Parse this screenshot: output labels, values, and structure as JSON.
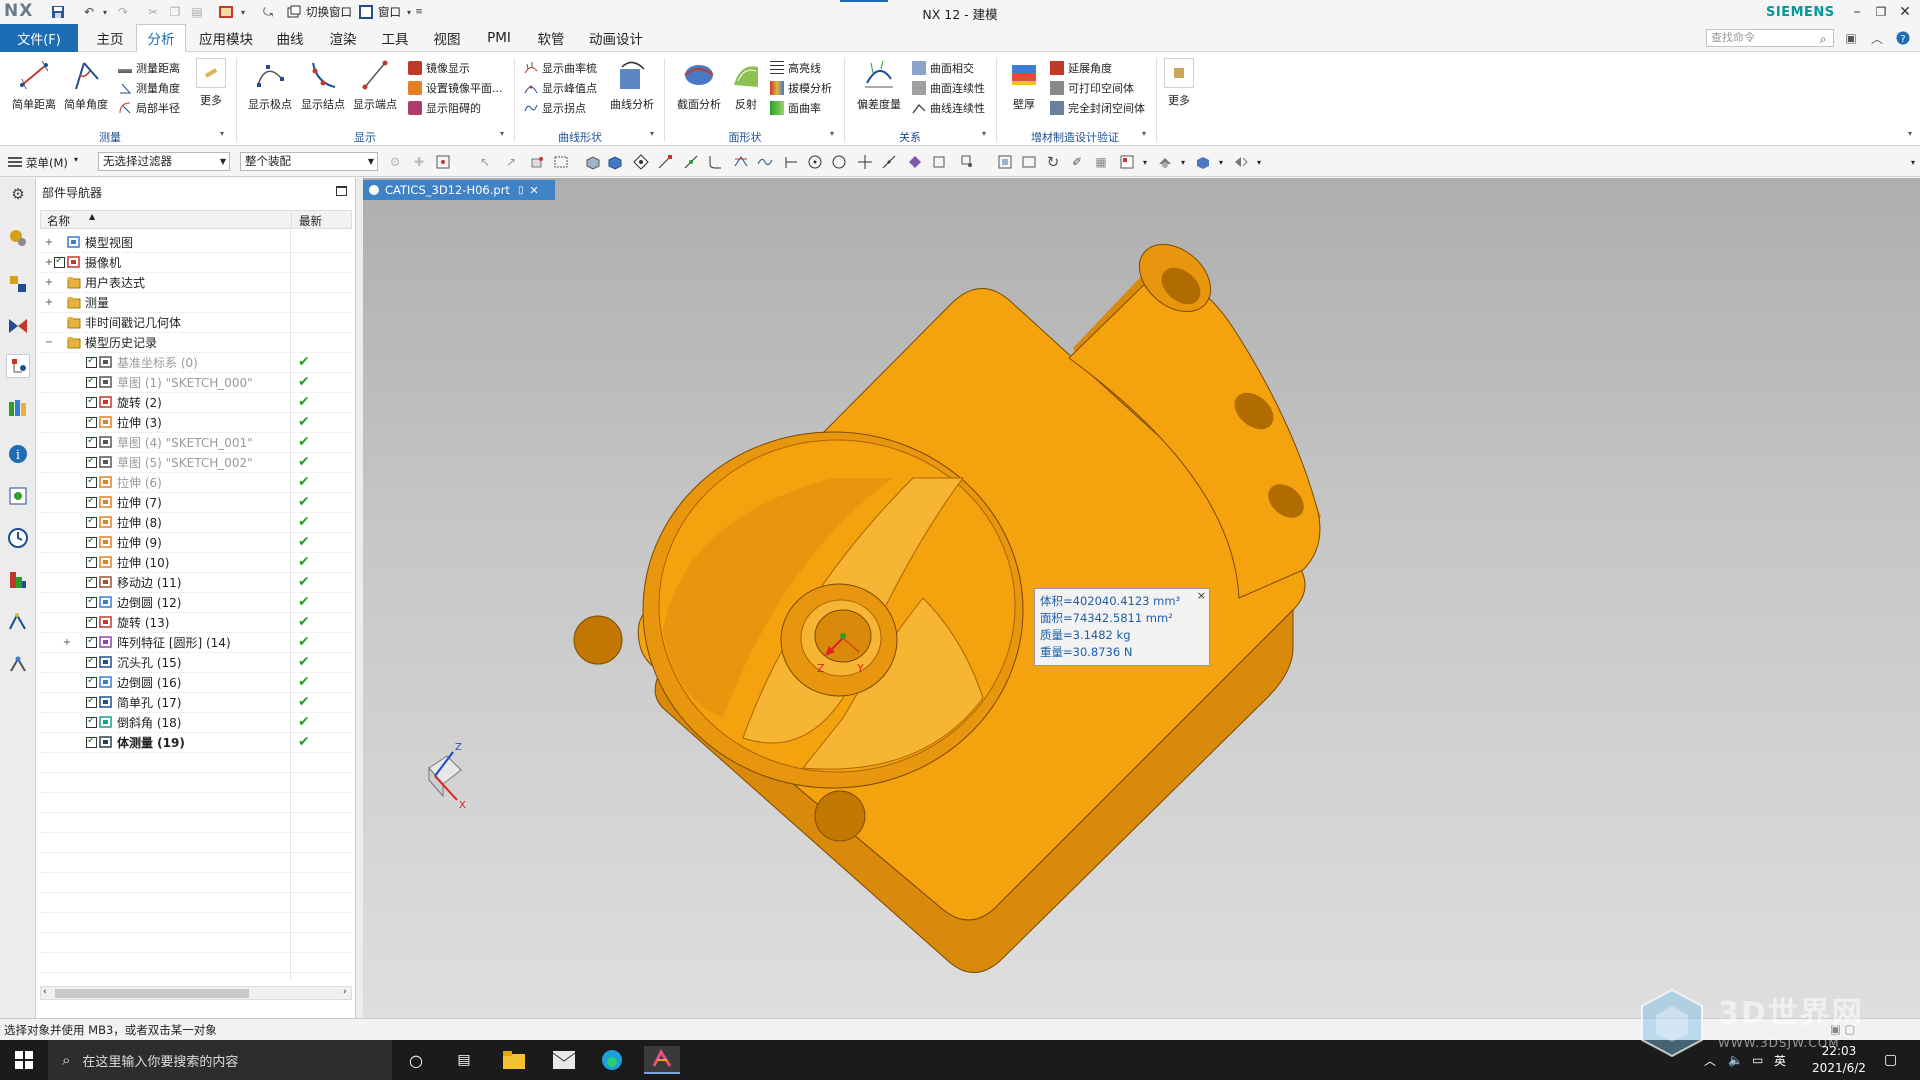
{
  "app": {
    "logo": "NX",
    "window_title": "NX 12 - 建模",
    "brand": "SIEMENS",
    "quick_access": {
      "switch_window": "切换窗口",
      "window": "窗口"
    }
  },
  "menu": {
    "file": "文件(F)",
    "tabs": [
      "主页",
      "分析",
      "应用模块",
      "曲线",
      "渲染",
      "工具",
      "视图",
      "PMI",
      "软管",
      "动画设计"
    ],
    "active_tab": "分析",
    "search_placeholder": "查找命令"
  },
  "ribbon": {
    "measure": {
      "label": "测量",
      "big": [
        "简单距离",
        "简单角度"
      ],
      "small": [
        "测量距离",
        "测量角度",
        "局部半径"
      ],
      "more": "更多"
    },
    "display": {
      "label": "显示",
      "big": [
        "显示极点",
        "显示结点",
        "显示端点"
      ],
      "small": [
        "镜像显示",
        "设置镜像平面...",
        "显示阻碍的"
      ]
    },
    "curve_shape": {
      "label": "曲线形状",
      "small": [
        "显示曲率梳",
        "显示峰值点",
        "显示拐点"
      ],
      "big": [
        "曲线分析"
      ]
    },
    "face_shape": {
      "label": "面形状",
      "big": [
        "截面分析",
        "反射"
      ],
      "small": [
        "高亮线",
        "拔模分析",
        "面曲率"
      ]
    },
    "relation": {
      "label": "关系",
      "big": [
        "偏差度量"
      ],
      "small": [
        "曲面相交",
        "曲面连续性",
        "曲线连续性"
      ]
    },
    "additive": {
      "label": "增材制造设计验证",
      "big": [
        "壁厚"
      ],
      "small": [
        "延展角度",
        "可打印空间体",
        "完全封闭空间体"
      ]
    },
    "more": "更多"
  },
  "toolbar2": {
    "menu": "菜单(M)",
    "filter": "无选择过滤器",
    "assembly": "整个装配"
  },
  "navigator": {
    "title": "部件导航器",
    "col_name": "名称",
    "col_latest": "最新",
    "rows": [
      {
        "label": "模型视图",
        "level": 0,
        "expand": "+",
        "icon": "model-views-icon",
        "gray": false,
        "check": false,
        "cb": false
      },
      {
        "label": "摄像机",
        "level": 0,
        "expand": "+",
        "icon": "camera-icon",
        "gray": false,
        "check": false,
        "cb": true
      },
      {
        "label": "用户表达式",
        "level": 0,
        "expand": "+",
        "icon": "folder-icon",
        "gray": false,
        "check": false,
        "cb": false
      },
      {
        "label": "测量",
        "level": 0,
        "expand": "+",
        "icon": "folder-icon",
        "gray": false,
        "check": false,
        "cb": false
      },
      {
        "label": "非时间戳记几何体",
        "level": 0,
        "expand": "",
        "icon": "folder-icon",
        "gray": false,
        "check": false,
        "cb": false
      },
      {
        "label": "模型历史记录",
        "level": 0,
        "expand": "−",
        "icon": "folder-icon",
        "gray": false,
        "check": false,
        "cb": false
      },
      {
        "label": "基准坐标系 (0)",
        "level": 1,
        "expand": "",
        "icon": "datum-csys-icon",
        "gray": true,
        "check": true,
        "cb": true
      },
      {
        "label": "草图 (1) \"SKETCH_000\"",
        "level": 1,
        "expand": "",
        "icon": "sketch-icon",
        "gray": true,
        "check": true,
        "cb": true
      },
      {
        "label": "旋转 (2)",
        "level": 1,
        "expand": "",
        "icon": "revolve-icon",
        "gray": false,
        "check": true,
        "cb": true
      },
      {
        "label": "拉伸 (3)",
        "level": 1,
        "expand": "",
        "icon": "extrude-icon",
        "gray": false,
        "check": true,
        "cb": true
      },
      {
        "label": "草图 (4) \"SKETCH_001\"",
        "level": 1,
        "expand": "",
        "icon": "sketch-icon",
        "gray": true,
        "check": true,
        "cb": true
      },
      {
        "label": "草图 (5) \"SKETCH_002\"",
        "level": 1,
        "expand": "",
        "icon": "sketch-icon",
        "gray": true,
        "check": true,
        "cb": true
      },
      {
        "label": "拉伸 (6)",
        "level": 1,
        "expand": "",
        "icon": "extrude-icon",
        "gray": true,
        "check": true,
        "cb": true
      },
      {
        "label": "拉伸 (7)",
        "level": 1,
        "expand": "",
        "icon": "extrude-icon",
        "gray": false,
        "check": true,
        "cb": true
      },
      {
        "label": "拉伸 (8)",
        "level": 1,
        "expand": "",
        "icon": "extrude-icon",
        "gray": false,
        "check": true,
        "cb": true
      },
      {
        "label": "拉伸 (9)",
        "level": 1,
        "expand": "",
        "icon": "extrude-icon",
        "gray": false,
        "check": true,
        "cb": true
      },
      {
        "label": "拉伸 (10)",
        "level": 1,
        "expand": "",
        "icon": "extrude-icon",
        "gray": false,
        "check": true,
        "cb": true
      },
      {
        "label": "移动边 (11)",
        "level": 1,
        "expand": "",
        "icon": "move-edge-icon",
        "gray": false,
        "check": true,
        "cb": true
      },
      {
        "label": "边倒圆 (12)",
        "level": 1,
        "expand": "",
        "icon": "edge-blend-icon",
        "gray": false,
        "check": true,
        "cb": true
      },
      {
        "label": "旋转 (13)",
        "level": 1,
        "expand": "",
        "icon": "revolve-icon",
        "gray": false,
        "check": true,
        "cb": true
      },
      {
        "label": "阵列特征 [圆形] (14)",
        "level": 1,
        "expand": "+",
        "icon": "pattern-icon",
        "gray": false,
        "check": true,
        "cb": true
      },
      {
        "label": "沉头孔 (15)",
        "level": 1,
        "expand": "",
        "icon": "countersink-hole-icon",
        "gray": false,
        "check": true,
        "cb": true
      },
      {
        "label": "边倒圆 (16)",
        "level": 1,
        "expand": "",
        "icon": "edge-blend-icon",
        "gray": false,
        "check": true,
        "cb": true
      },
      {
        "label": "简单孔 (17)",
        "level": 1,
        "expand": "",
        "icon": "simple-hole-icon",
        "gray": false,
        "check": true,
        "cb": true
      },
      {
        "label": "倒斜角 (18)",
        "level": 1,
        "expand": "",
        "icon": "chamfer-icon",
        "gray": false,
        "check": true,
        "cb": true
      },
      {
        "label": "体测量 (19)",
        "level": 1,
        "expand": "",
        "icon": "body-measure-icon",
        "gray": false,
        "check": true,
        "cb": true,
        "bold": true
      }
    ]
  },
  "graphics": {
    "doc_tab": "CATICS_3D12-H06.prt",
    "measure_info": [
      "体积=402040.4123 mm³",
      "面积=74342.5811 mm²",
      "质量=3.1482 kg",
      "重量=30.8736 N"
    ],
    "triad_labels": {
      "x": "X",
      "y": "Y",
      "z": "Z"
    },
    "part_color": "#f5a20f"
  },
  "statusbar": {
    "prompt": "选择对象并使用 MB3，或者双击某一对象"
  },
  "taskbar": {
    "search_placeholder": "在这里输入你要搜索的内容",
    "time": "22:03",
    "date": "2021/6/2",
    "ime": "英"
  },
  "watermark": {
    "main": "3D世界网",
    "sub": "WWW.3DSJW.COM"
  }
}
